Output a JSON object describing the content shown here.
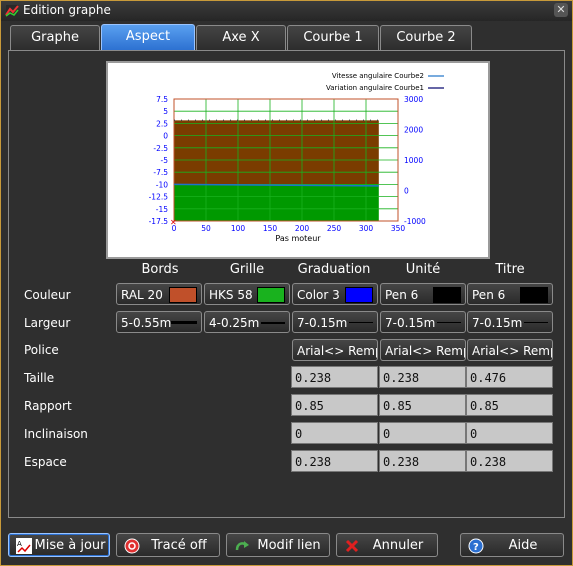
{
  "window": {
    "title": "Edition graphe",
    "close_glyph": "✕"
  },
  "tabs": [
    {
      "label": "Graphe",
      "active": false
    },
    {
      "label": "Aspect",
      "active": true
    },
    {
      "label": "Axe X",
      "active": false
    },
    {
      "label": "Courbe 1",
      "active": false
    },
    {
      "label": "Courbe 2",
      "active": false
    }
  ],
  "chart_data": {
    "type": "area",
    "xlabel": "Pas moteur",
    "x_ticks": [
      "0",
      "50",
      "100",
      "150",
      "200",
      "250",
      "300",
      "350"
    ],
    "xlim": [
      0,
      350
    ],
    "y_left_ticks": [
      "7.5",
      "5",
      "2.5",
      "0",
      "-2.5",
      "-5",
      "-7.5",
      "-10",
      "-12.5",
      "-15",
      "-17.5"
    ],
    "ylim_left": [
      -17.5,
      7.5
    ],
    "y_right_ticks": [
      "3000",
      "2000",
      "1000",
      "0",
      "-1000"
    ],
    "ylim_right": [
      -1000,
      3000
    ],
    "grid": true,
    "legend_position": "top-right",
    "series": [
      {
        "name": "Vitesse angulaire  Courbe2",
        "color": "#1e73c8",
        "axis": "right",
        "x": [
          0,
          320
        ],
        "y": [
          2300,
          2300
        ]
      },
      {
        "name": "Variation angulaire  Courbe1",
        "color": "#00006a",
        "axis": "left",
        "x": [
          0,
          320
        ],
        "y": [
          -10,
          -10.3
        ]
      }
    ],
    "colors": {
      "bords": "#c0502a",
      "grille": "#19b21e",
      "graduation": "#0000ff"
    }
  },
  "columns": [
    "Bords",
    "Grille",
    "Graduation",
    "Unité",
    "Titre"
  ],
  "rows": {
    "couleur": {
      "label": "Couleur",
      "cells": [
        {
          "text": "RAL 20",
          "color": "#c0502a"
        },
        {
          "text": "HKS 58",
          "color": "#19b21e"
        },
        {
          "text": "Color 3",
          "color": "#0000ff"
        },
        {
          "text": "Pen 6",
          "color": "#000000"
        },
        {
          "text": "Pen 6",
          "color": "#000000"
        }
      ]
    },
    "largeur": {
      "label": "Largeur",
      "cells": [
        "5-0.55m",
        "4-0.25m",
        "7-0.15m",
        "7-0.15m",
        "7-0.15m"
      ]
    },
    "police": {
      "label": "Police",
      "cells": [
        "Arial<> Rempl",
        "Arial<> Rempl",
        "Arial<> Remp"
      ]
    },
    "taille": {
      "label": "Taille",
      "cells": [
        "0.238",
        "0.238",
        "0.476"
      ]
    },
    "rapport": {
      "label": "Rapport",
      "cells": [
        "0.85",
        "0.85",
        "0.85"
      ]
    },
    "inclinaison": {
      "label": "Inclinaison",
      "cells": [
        "0",
        "0",
        "0"
      ]
    },
    "espace": {
      "label": "Espace",
      "cells": [
        "0.238",
        "0.238",
        "0.238"
      ]
    }
  },
  "buttons": {
    "mise_a_jour": "Mise à jour",
    "trace_off": "Tracé off",
    "modif_lien": "Modif lien",
    "annuler": "Annuler",
    "aide": "Aide"
  }
}
